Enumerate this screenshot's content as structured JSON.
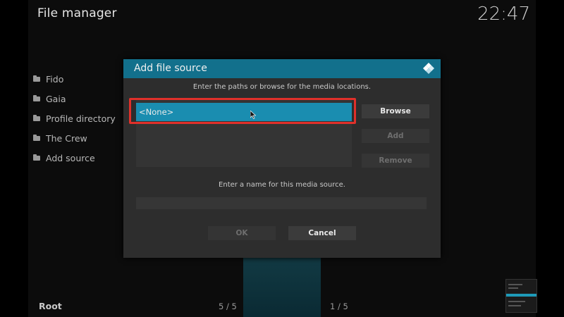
{
  "app": {
    "title": "File manager",
    "clock": "22:47"
  },
  "sources": [
    {
      "label": "Fido"
    },
    {
      "label": "Gaia"
    },
    {
      "label": "Profile directory"
    },
    {
      "label": "The Crew"
    },
    {
      "label": "Add source"
    }
  ],
  "footer": {
    "root_label": "Root",
    "left_count": "5 / 5",
    "right_count": "1 / 5"
  },
  "dialog": {
    "title": "Add file source",
    "paths_instruction": "Enter the paths or browse for the media locations.",
    "path_value": "<None>",
    "buttons": {
      "browse": "Browse",
      "add": "Add",
      "remove": "Remove",
      "ok": "OK",
      "cancel": "Cancel"
    },
    "name_instruction": "Enter a name for this media source.",
    "name_value": ""
  },
  "colors": {
    "accent": "#12708c",
    "selection": "#1a8db0",
    "highlight": "#e0302a"
  },
  "icons": {
    "folder": "folder-icon",
    "logo": "kodi-logo-icon",
    "pointer": "mouse-pointer-icon"
  }
}
